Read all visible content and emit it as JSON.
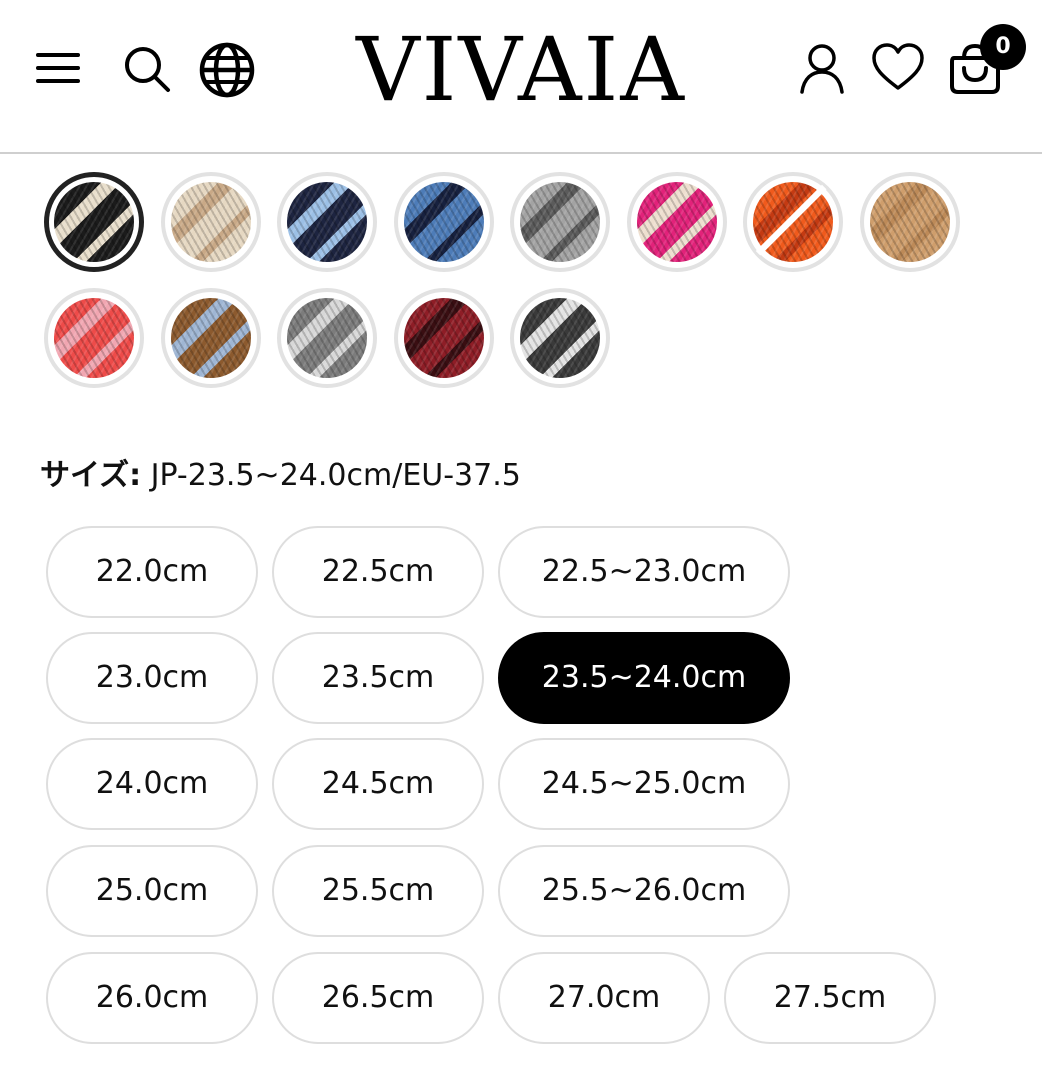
{
  "header": {
    "logo": "VIVAIA",
    "cart_count": "0",
    "icons": [
      "menu-icon",
      "search-icon",
      "globe-icon",
      "account-icon",
      "heart-icon",
      "cart-icon"
    ]
  },
  "swatches": [
    {
      "name": "black",
      "color": "#1b1b1b",
      "stripe": "#e9dfcc",
      "selected": true,
      "sold_out": false
    },
    {
      "name": "beige",
      "color": "#e6d8c2",
      "stripe": "#c9a987",
      "selected": false,
      "sold_out": false
    },
    {
      "name": "navy",
      "color": "#1d2440",
      "stripe": "#9cc0e6",
      "selected": false,
      "sold_out": false
    },
    {
      "name": "denim-blue",
      "color": "#4d7cb8",
      "stripe": "#17213f",
      "selected": false,
      "sold_out": false
    },
    {
      "name": "grey",
      "color": "#a3a3a3",
      "stripe": "#5b5b5b",
      "selected": false,
      "sold_out": false
    },
    {
      "name": "pink",
      "color": "#e2227a",
      "stripe": "#eedfcf",
      "selected": false,
      "sold_out": false
    },
    {
      "name": "orange",
      "color": "#f05a1c",
      "stripe": "#c43a12",
      "selected": false,
      "sold_out": true
    },
    {
      "name": "camel",
      "color": "#cf9e6c",
      "stripe": "#bd8a58",
      "selected": false,
      "sold_out": false
    },
    {
      "name": "coral-multi",
      "color": "#ee4b49",
      "stripe": "#f1a6b1",
      "selected": false,
      "sold_out": false
    },
    {
      "name": "brown-plaid",
      "color": "#8c5a2e",
      "stripe": "#9fb6d4",
      "selected": false,
      "sold_out": false
    },
    {
      "name": "grey-pattern",
      "color": "#7c7c7c",
      "stripe": "#d8d8d8",
      "selected": false,
      "sold_out": false
    },
    {
      "name": "burgundy",
      "color": "#8e1d26",
      "stripe": "#3a0e12",
      "selected": false,
      "sold_out": false
    },
    {
      "name": "black-white-pattern",
      "color": "#3a3a3a",
      "stripe": "#e3e3e3",
      "selected": false,
      "sold_out": false
    }
  ],
  "size_section": {
    "label": "サイズ:",
    "value": "JP-23.5~24.0cm/EU-37.5"
  },
  "sizes": [
    {
      "label": "22.0cm",
      "selected": false
    },
    {
      "label": "22.5cm",
      "selected": false
    },
    {
      "label": "22.5~23.0cm",
      "selected": false
    },
    {
      "label": "23.0cm",
      "selected": false
    },
    {
      "label": "23.5cm",
      "selected": false
    },
    {
      "label": "23.5~24.0cm",
      "selected": true
    },
    {
      "label": "24.0cm",
      "selected": false
    },
    {
      "label": "24.5cm",
      "selected": false
    },
    {
      "label": "24.5~25.0cm",
      "selected": false
    },
    {
      "label": "25.0cm",
      "selected": false
    },
    {
      "label": "25.5cm",
      "selected": false
    },
    {
      "label": "25.5~26.0cm",
      "selected": false
    },
    {
      "label": "26.0cm",
      "selected": false
    },
    {
      "label": "26.5cm",
      "selected": false
    },
    {
      "label": "27.0cm",
      "selected": false
    },
    {
      "label": "27.5cm",
      "selected": false
    }
  ]
}
